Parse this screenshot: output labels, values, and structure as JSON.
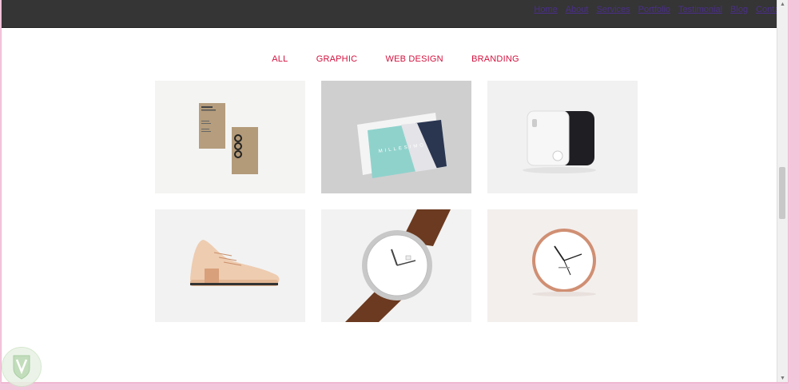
{
  "nav": {
    "items": [
      "Home",
      "About",
      "Services",
      "Portfolio",
      "Testimonial",
      "Blog",
      "Contact"
    ]
  },
  "filters": {
    "items": [
      "ALL",
      "GRAPHIC",
      "WEB DESIGN",
      "BRANDING"
    ]
  },
  "portfolio": {
    "tiles": [
      {
        "name": "business-cards-kraft"
      },
      {
        "name": "business-card-millesimo"
      },
      {
        "name": "portable-device"
      },
      {
        "name": "sneaker"
      },
      {
        "name": "wristwatch"
      },
      {
        "name": "wall-clock"
      }
    ],
    "card_brand": "MILLESIMO"
  },
  "colors": {
    "topbar": "#353535",
    "nav_link": "#4a2f8a",
    "filter_accent": "#d3123f",
    "page_border": "#f3c6dc"
  }
}
